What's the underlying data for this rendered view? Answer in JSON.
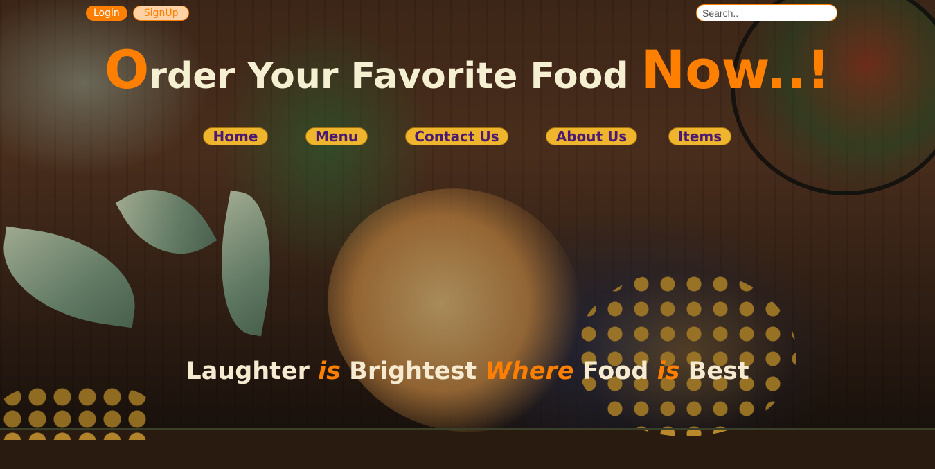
{
  "auth": {
    "login_label": "Login",
    "signup_label": "SignUp"
  },
  "search": {
    "placeholder": "Search.."
  },
  "headline": {
    "first_letter": "O",
    "middle": "rder Your Favorite Food ",
    "last": "Now..!"
  },
  "nav": {
    "items": [
      {
        "label": "Home"
      },
      {
        "label": "Menu"
      },
      {
        "label": "Contact Us"
      },
      {
        "label": "About Us"
      },
      {
        "label": "Items"
      }
    ]
  },
  "tagline": {
    "w1": "Laughter ",
    "w2": "is",
    "w3": " Brightest ",
    "w4": "Where",
    "w5": " Food ",
    "w6": "is",
    "w7": " Best"
  },
  "colors": {
    "accent": "#ff7f00",
    "nav_bg": "#efb52c",
    "nav_text": "#4b1a73",
    "headline_text": "#f6f0d2"
  }
}
